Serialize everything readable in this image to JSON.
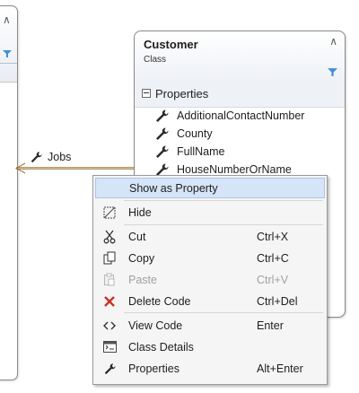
{
  "class_shape": {
    "name": "Customer",
    "kind": "Class",
    "compartment_label": "Properties",
    "members": [
      "AdditionalContactNumber",
      "County",
      "FullName",
      "HouseNumberOrName"
    ]
  },
  "association": {
    "label": "Jobs"
  },
  "context_menu": {
    "items": [
      {
        "label": "Show as Property",
        "shortcut": "",
        "icon": "none"
      },
      {
        "label": "Hide",
        "shortcut": "",
        "icon": "hide-icon"
      },
      {
        "label": "Cut",
        "shortcut": "Ctrl+X",
        "icon": "scissors-icon"
      },
      {
        "label": "Copy",
        "shortcut": "Ctrl+C",
        "icon": "copy-icon"
      },
      {
        "label": "Paste",
        "shortcut": "Ctrl+V",
        "icon": "paste-icon"
      },
      {
        "label": "Delete Code",
        "shortcut": "Ctrl+Del",
        "icon": "delete-x-icon"
      },
      {
        "label": "View Code",
        "shortcut": "Enter",
        "icon": "code-brackets-icon"
      },
      {
        "label": "Class Details",
        "shortcut": "",
        "icon": "class-details-icon"
      },
      {
        "label": "Properties",
        "shortcut": "Alt+Enter",
        "icon": "wrench-icon"
      }
    ]
  },
  "colors": {
    "highlight": "#d5e4f7",
    "delete_red": "#c8312a",
    "filter_blue": "#3f8fd6"
  }
}
